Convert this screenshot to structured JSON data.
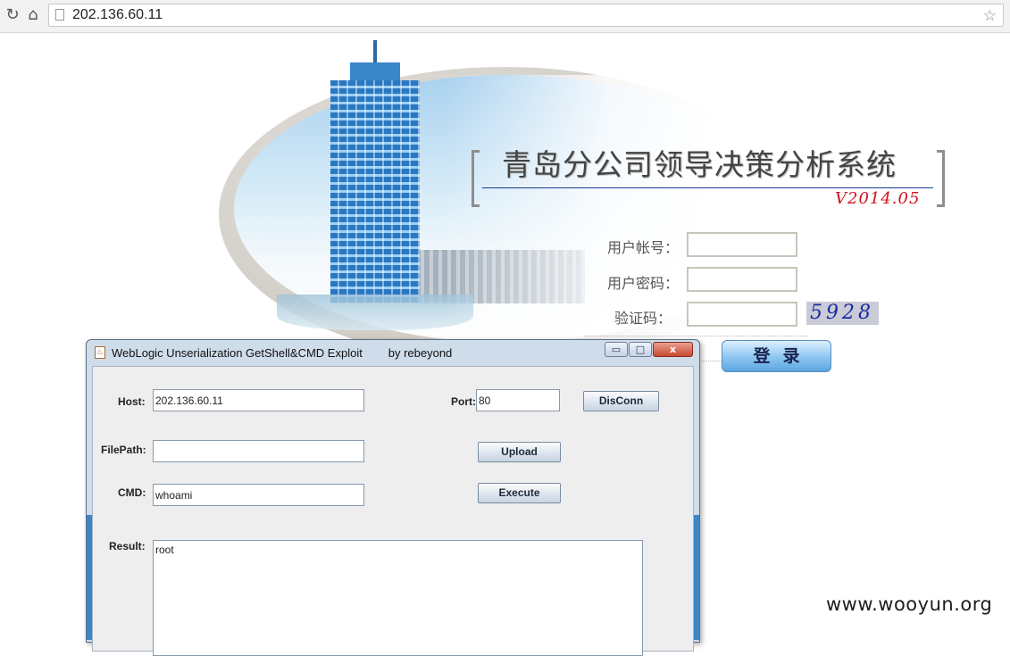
{
  "browser": {
    "url": "202.136.60.11",
    "icons": {
      "reload": "reload-icon",
      "home": "home-icon",
      "page": "page-icon",
      "bookmark": "star-icon"
    }
  },
  "login_page": {
    "title": "青岛分公司领导决策分析系统",
    "version": "V2014.05",
    "username_label": "用户帐号：",
    "password_label": "用户密码：",
    "captcha_label": "验证码：",
    "captcha_code": "5928",
    "login_button": "登录"
  },
  "java_window": {
    "title": "WebLogic Unserialization GetShell&CMD Exploit",
    "author": "by rebeyond",
    "host_label": "Host:",
    "host_value": "202.136.60.11",
    "port_label": "Port:",
    "port_value": "80",
    "disconnect_button": "DisConn",
    "filepath_label": "FilePath:",
    "filepath_value": "",
    "upload_button": "Upload",
    "cmd_label": "CMD:",
    "cmd_value": "whoami",
    "execute_button": "Execute",
    "result_label": "Result:",
    "result_value": "root",
    "controls": {
      "minimize": "▭",
      "maximize": "□",
      "close": "x"
    }
  },
  "watermark": "www.wooyun.org",
  "colors": {
    "title_text": "#444444",
    "version_red": "#d0101a",
    "captcha_blue": "#1c2aa4",
    "window_frame": "#cfdcea"
  }
}
